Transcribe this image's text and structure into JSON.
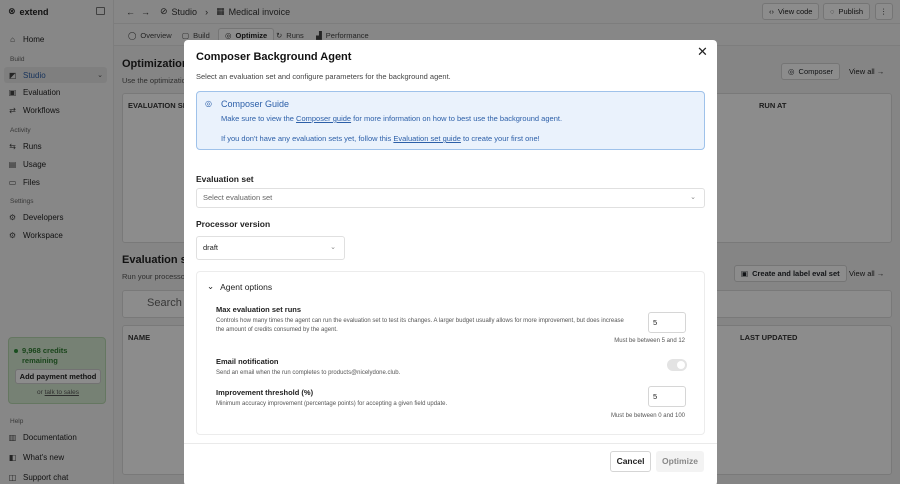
{
  "brand": {
    "name": "extend"
  },
  "sidebar": {
    "home": "Home",
    "section_build": "Build",
    "studio": "Studio",
    "evaluation": "Evaluation",
    "workflows": "Workflows",
    "section_activity": "Activity",
    "runs": "Runs",
    "usage": "Usage",
    "files": "Files",
    "section_settings": "Settings",
    "developers": "Developers",
    "workspace": "Workspace",
    "section_help": "Help",
    "documentation": "Documentation",
    "whats_new": "What's new",
    "support_chat": "Support chat"
  },
  "credits": {
    "text": "9,968 credits remaining",
    "button": "Add payment method",
    "or": "or",
    "talk_link": "talk to sales"
  },
  "topbar": {
    "crumb_studio": "Studio",
    "crumb_page": "Medical invoice",
    "view_code": "View code",
    "publish": "Publish"
  },
  "tabs": [
    "Overview",
    "Build",
    "Optimize",
    "Runs",
    "Performance"
  ],
  "background": {
    "opt_title": "Optimization r",
    "opt_sub": "Use the optimizatio",
    "composer_btn": "Composer",
    "view_all": "View all",
    "col_eval_set": "EVALUATION SE",
    "col_run_at": "RUN AT",
    "eval_title": "Evaluation se",
    "eval_sub": "Run your processo",
    "create_btn": "Create and label eval set",
    "view_all_2": "View all",
    "search_placeholder": "Search e",
    "col_name": "NAME",
    "col_last_updated": "LAST UPDATED"
  },
  "modal": {
    "title": "Composer Background Agent",
    "subtitle": "Select an evaluation set and configure parameters for the background agent.",
    "guide_title": "Composer Guide",
    "guide_line1_a": "Make sure to view the ",
    "guide_line1_link": "Composer guide",
    "guide_line1_b": " for more information on how to best use the background agent.",
    "guide_line2_a": "If you don't have any evaluation sets yet, follow this ",
    "guide_line2_link": "Evaluation set guide",
    "guide_line2_b": " to create your first one!",
    "eval_set_label": "Evaluation set",
    "eval_set_placeholder": "Select evaluation set",
    "processor_label": "Processor version",
    "processor_value": "draft",
    "agent_options": "Agent options",
    "max_runs_title": "Max evaluation set runs",
    "max_runs_desc": "Controls how many times the agent can run the evaluation set to test its changes. A larger budget usually allows for more improvement, but does increase the amount of credits consumed by the agent.",
    "max_runs_value": "5",
    "max_runs_hint": "Must be between 5 and 12",
    "email_title": "Email notification",
    "email_desc": "Send an email when the run completes to products@nicelydone.club.",
    "threshold_title": "Improvement threshold (%)",
    "threshold_desc": "Minimum accuracy improvement (percentage points) for accepting a given field update.",
    "threshold_value": "5",
    "threshold_hint": "Must be between 0 and 100",
    "cancel": "Cancel",
    "optimize": "Optimize"
  }
}
